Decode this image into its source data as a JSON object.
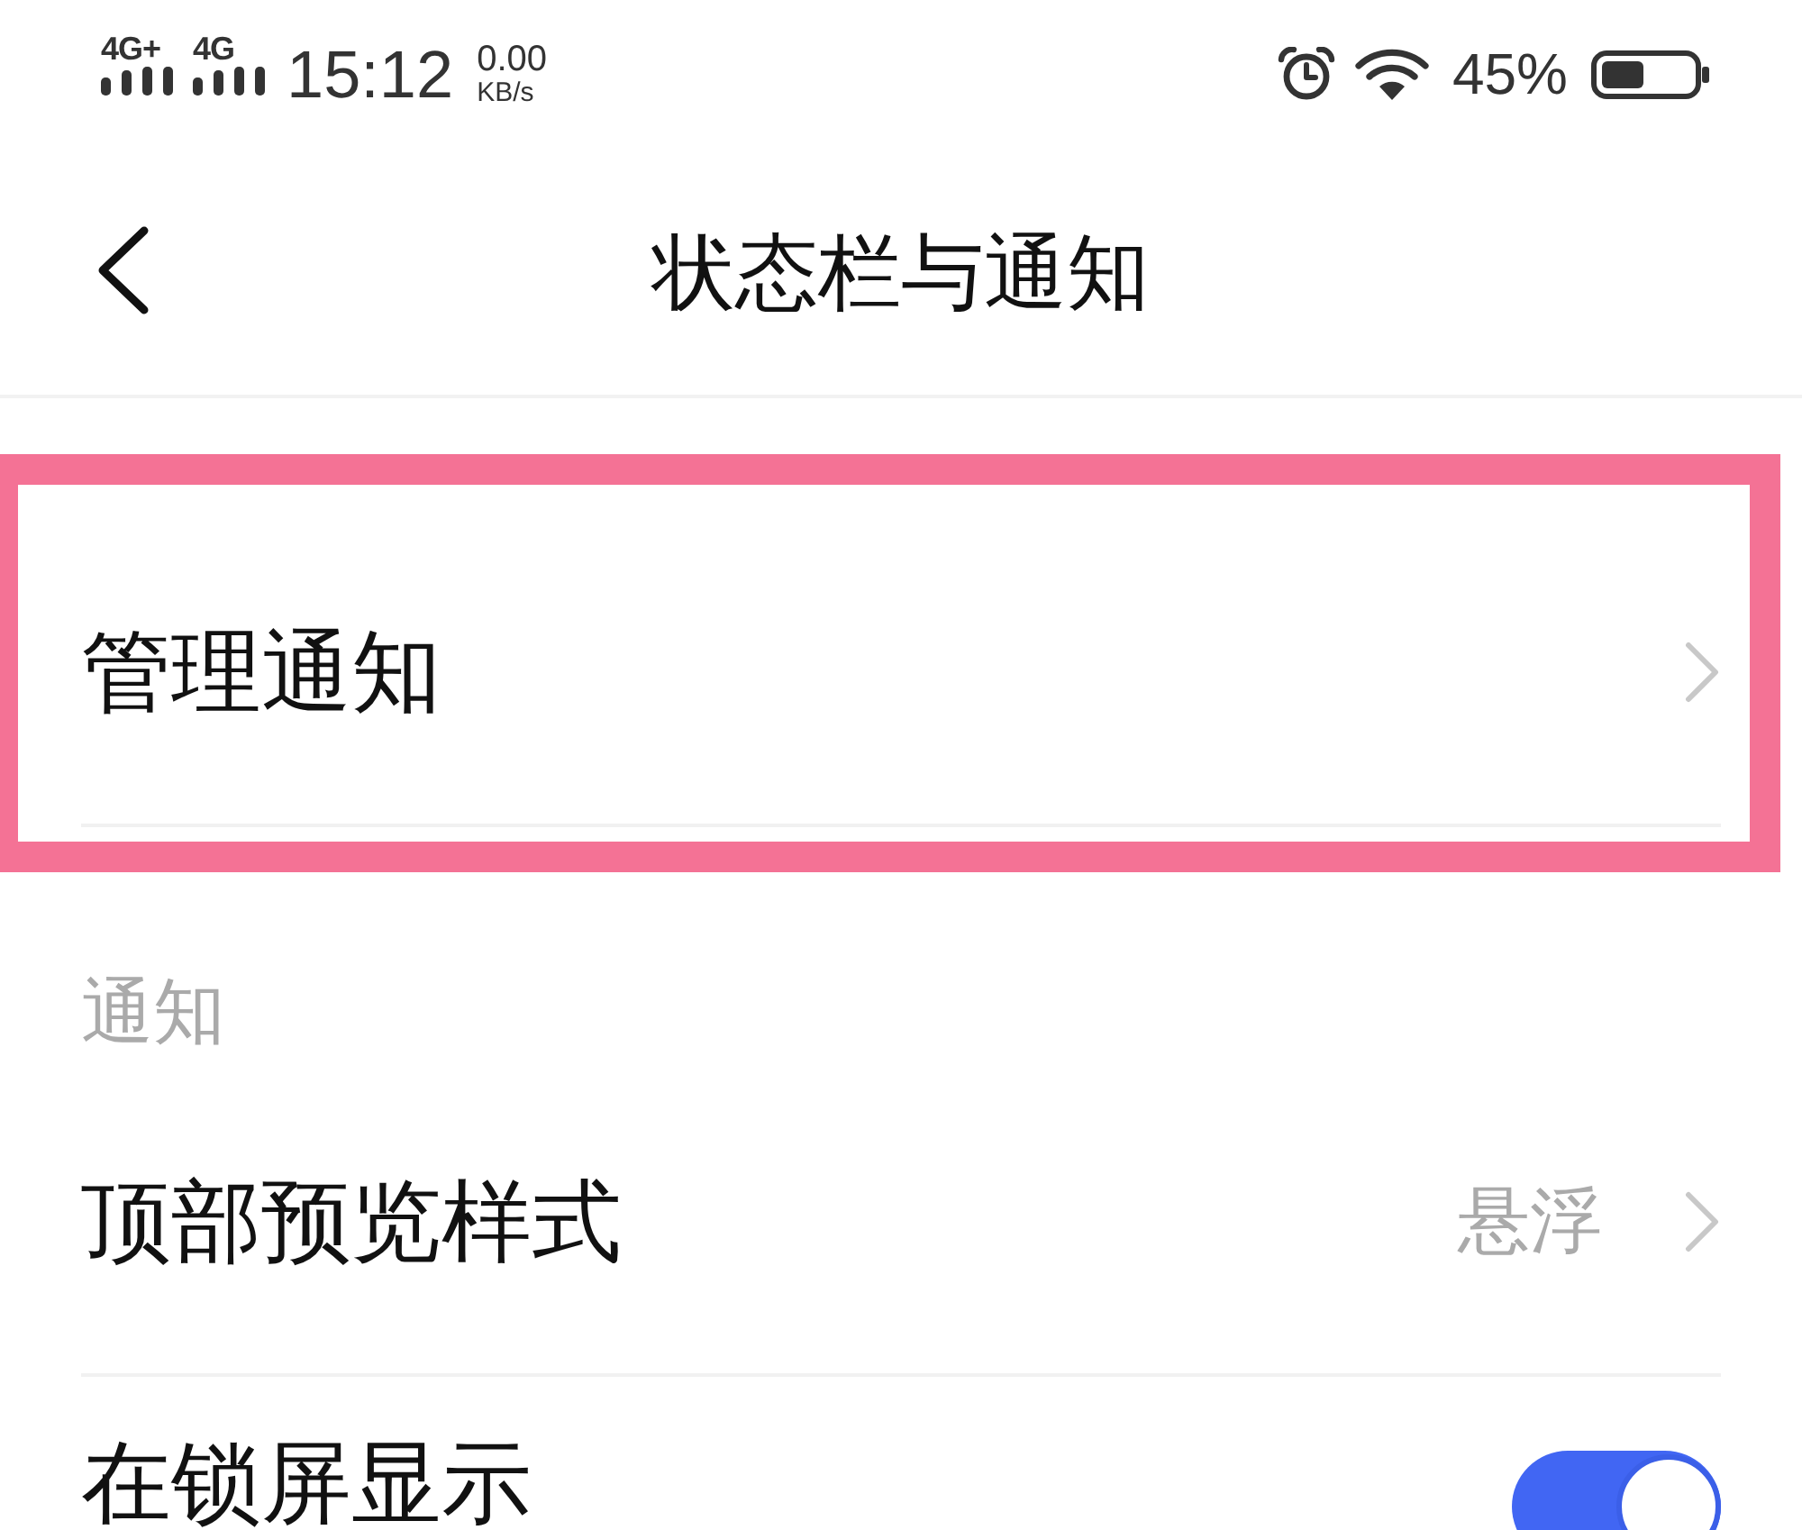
{
  "status_bar": {
    "networks": [
      "4G+",
      "4G"
    ],
    "time": "15:12",
    "speed": {
      "value": "0.00",
      "unit": "KB/s"
    },
    "battery": "45%"
  },
  "header": {
    "title": "状态栏与通知"
  },
  "sections": [
    {
      "rows": [
        {
          "kind": "link",
          "label": "管理通知",
          "highlighted": true
        }
      ]
    },
    {
      "title": "通知",
      "rows": [
        {
          "kind": "link",
          "label": "顶部预览样式",
          "value": "悬浮",
          "highlighted": false
        },
        {
          "kind": "switch",
          "label": "在锁屏显示",
          "on": true,
          "highlighted": false
        }
      ]
    }
  ]
}
